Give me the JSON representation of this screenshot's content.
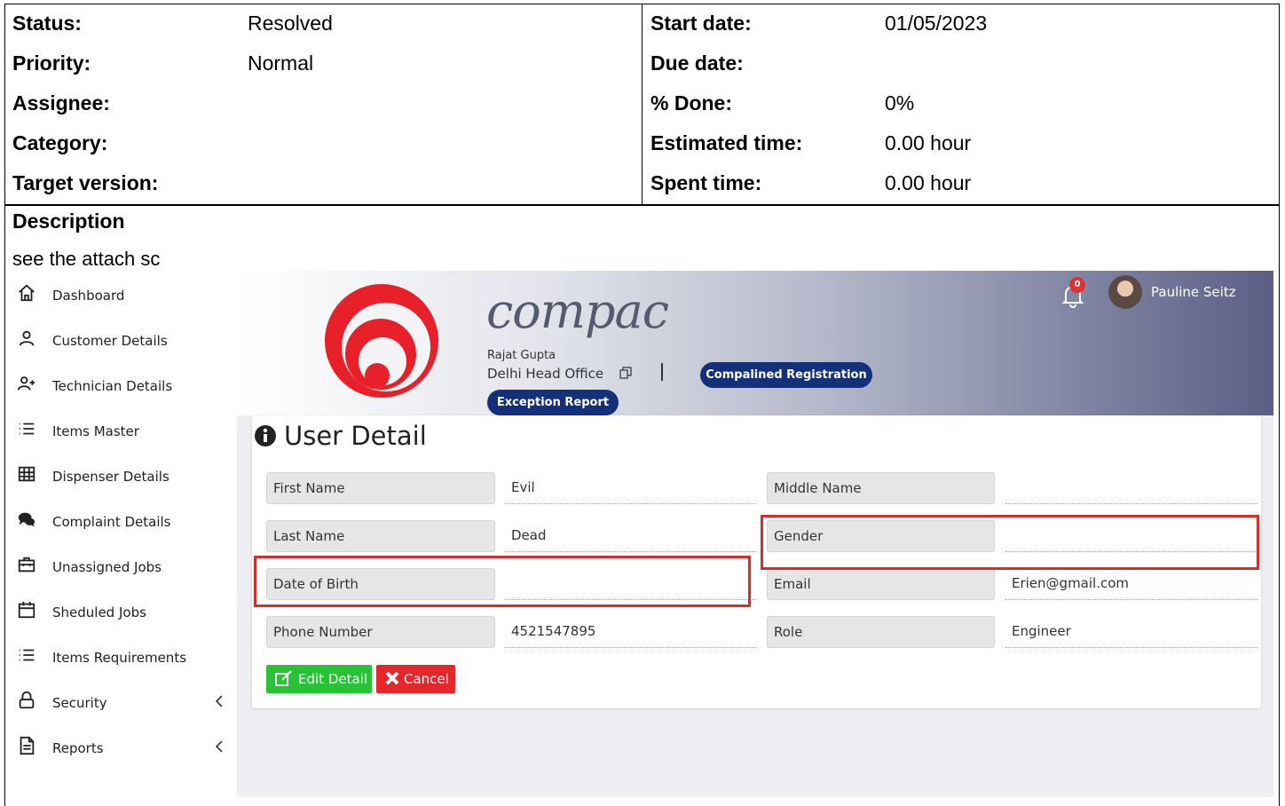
{
  "issue": {
    "left": [
      {
        "label": "Status:",
        "value": "Resolved"
      },
      {
        "label": "Priority:",
        "value": "Normal"
      },
      {
        "label": "Assignee:",
        "value": ""
      },
      {
        "label": "Category:",
        "value": ""
      },
      {
        "label": "Target version:",
        "value": ""
      }
    ],
    "right": [
      {
        "label": "Start date:",
        "value": "01/05/2023"
      },
      {
        "label": "Due date:",
        "value": ""
      },
      {
        "label": "% Done:",
        "value": "0%"
      },
      {
        "label": "Estimated time:",
        "value": "0.00 hour"
      },
      {
        "label": "Spent time:",
        "value": "0.00 hour"
      }
    ],
    "description_heading": "Description",
    "description_text": "see the attach sc"
  },
  "app": {
    "sidebar": [
      {
        "label": "Dashboard",
        "icon": "home-icon"
      },
      {
        "label": "Customer Details",
        "icon": "user-icon"
      },
      {
        "label": "Technician Details",
        "icon": "user-plus-icon"
      },
      {
        "label": "Items Master",
        "icon": "list-icon"
      },
      {
        "label": "Dispenser Details",
        "icon": "table-icon"
      },
      {
        "label": "Complaint Details",
        "icon": "chat-icon"
      },
      {
        "label": "Unassigned Jobs",
        "icon": "briefcase-icon"
      },
      {
        "label": "Sheduled Jobs",
        "icon": "calendar-icon"
      },
      {
        "label": "Items Requirements",
        "icon": "list-icon"
      },
      {
        "label": "Security",
        "icon": "lock-icon"
      },
      {
        "label": "Reports",
        "icon": "document-icon"
      }
    ],
    "header": {
      "brand": "compac",
      "user_small": "Rajat Gupta",
      "office": "Delhi Head Office",
      "complain_button": "Compalined Registration",
      "exception_button": "Exception Report",
      "notification_count": "0",
      "user_name": "Pauline Seitz"
    },
    "card": {
      "title": "User Detail",
      "fields": [
        {
          "label": "First Name",
          "value": "Evil"
        },
        {
          "label": "Middle Name",
          "value": ""
        },
        {
          "label": "Last Name",
          "value": "Dead"
        },
        {
          "label": "Gender",
          "value": ""
        },
        {
          "label": "Date of Birth",
          "value": ""
        },
        {
          "label": "Email",
          "value": "Erien@gmail.com"
        },
        {
          "label": "Phone Number",
          "value": "4521547895"
        },
        {
          "label": "Role",
          "value": "Engineer"
        }
      ],
      "edit_button": "Edit Detail",
      "cancel_button": "Cancel"
    },
    "colors": {
      "brand_red": "#e8202a",
      "pill_blue": "#14307a",
      "edit_green": "#27c235",
      "cancel_red": "#e5262b",
      "highlight_red": "#d32f2f"
    }
  }
}
